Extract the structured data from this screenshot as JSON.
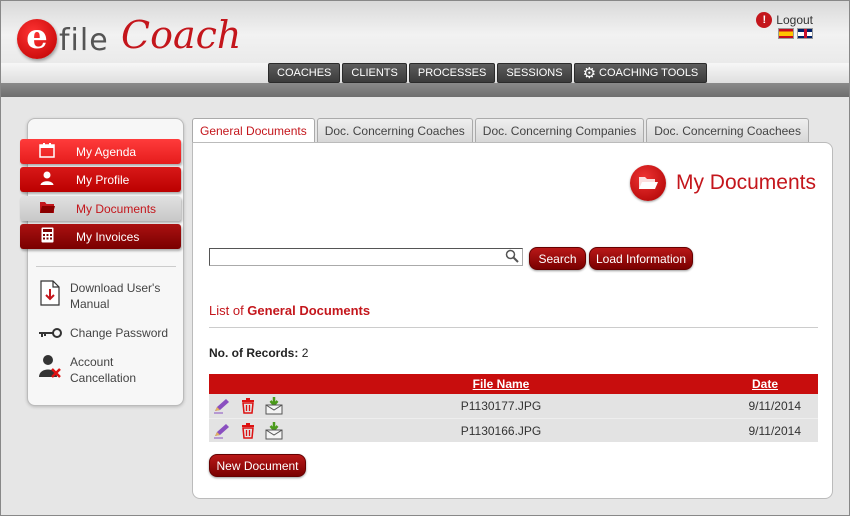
{
  "header": {
    "logo_e": "e",
    "logo_file": "file",
    "logo_coach": "Coach",
    "logout_label": "Logout",
    "nav": [
      {
        "label": "COACHES"
      },
      {
        "label": "CLIENTS"
      },
      {
        "label": "PROCESSES"
      },
      {
        "label": "SESSIONS"
      },
      {
        "label": "COACHING TOOLS",
        "icon": "gear-icon"
      }
    ]
  },
  "sidebar": {
    "menu": [
      {
        "label": "My Agenda",
        "icon": "calendar-icon"
      },
      {
        "label": "My Profile",
        "icon": "user-icon"
      },
      {
        "label": "My Documents",
        "icon": "folder-icon"
      },
      {
        "label": "My Invoices",
        "icon": "calculator-icon"
      }
    ],
    "links": [
      {
        "label": "Download User's Manual",
        "icon": "pdf-download-icon"
      },
      {
        "label": "Change Password",
        "icon": "key-icon"
      },
      {
        "label": "Account Cancellation",
        "icon": "user-remove-icon"
      }
    ]
  },
  "tabs": [
    {
      "label": "General Documents",
      "active": true
    },
    {
      "label": "Doc. Concerning Coaches"
    },
    {
      "label": "Doc. Concerning Companies"
    },
    {
      "label": "Doc. Concerning Coachees"
    }
  ],
  "main": {
    "page_title": "My Documents",
    "search": {
      "value": "",
      "placeholder": ""
    },
    "search_button": "Search",
    "load_button": "Load Information",
    "list_prefix": "List of ",
    "list_name": "General Documents",
    "records_label": "No. of Records:",
    "records_count": "2",
    "table": {
      "headers": {
        "file": "File Name",
        "date": "Date"
      },
      "rows": [
        {
          "file": "P1130177.JPG",
          "date": "9/11/2014"
        },
        {
          "file": "P1130166.JPG",
          "date": "9/11/2014"
        }
      ]
    },
    "new_button": "New Document"
  },
  "colors": {
    "brand_red": "#c4161c",
    "nav_dark": "#444444",
    "table_header": "#c80d0d"
  }
}
